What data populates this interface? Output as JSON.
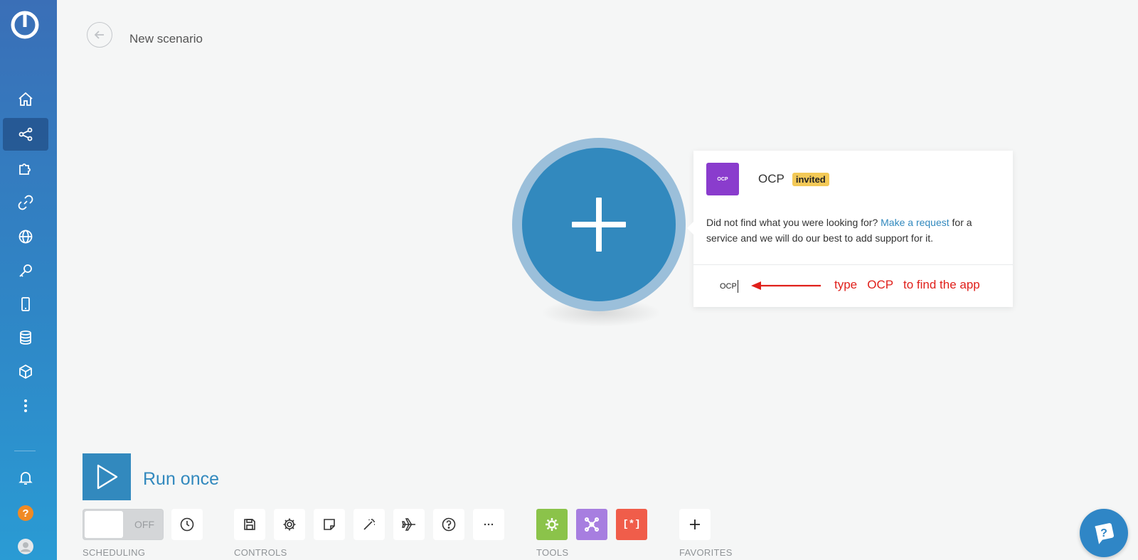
{
  "header": {
    "title": "New scenario"
  },
  "sidebar": {
    "items": [
      {
        "icon": "home-icon"
      },
      {
        "icon": "scenarios-icon",
        "active": true
      },
      {
        "icon": "puzzle-icon"
      },
      {
        "icon": "link-icon"
      },
      {
        "icon": "globe-icon"
      },
      {
        "icon": "key-icon"
      },
      {
        "icon": "device-icon"
      },
      {
        "icon": "database-icon"
      },
      {
        "icon": "cube-icon"
      },
      {
        "icon": "more-vertical-icon"
      }
    ],
    "bottom": [
      {
        "icon": "bell-icon"
      },
      {
        "icon": "help-icon",
        "color": "#f08a24"
      },
      {
        "icon": "avatar"
      }
    ]
  },
  "popup": {
    "app": {
      "icon_text": "OCP",
      "name": "OCP",
      "badge": "invited",
      "icon_color": "#8a3ccd",
      "badge_color": "#f3c957"
    },
    "help_prefix": "Did not find what you were looking for?",
    "help_link": "Make a request",
    "help_suffix": "for a service and we will do our best to add support for it.",
    "search_value": "OCP"
  },
  "annotation": {
    "text": "type   OCP   to find the app",
    "color": "#e0201b"
  },
  "run": {
    "label": "Run once"
  },
  "toolbar": {
    "scheduling": {
      "toggle_label": "OFF",
      "section_label": "SCHEDULING"
    },
    "controls": {
      "section_label": "CONTROLS",
      "buttons": [
        "save-icon",
        "settings-icon",
        "notes-icon",
        "auto-align-icon",
        "flight-icon",
        "question-icon",
        "more-horizontal-icon"
      ],
      "more_label": "···"
    },
    "tools": {
      "section_label": "TOOLS",
      "buttons": [
        {
          "icon": "gear-tool-icon",
          "color": "#8bc34a"
        },
        {
          "icon": "flow-control-icon",
          "color": "#a77ee0"
        },
        {
          "icon": "text-parser-icon",
          "color": "#f05d4a",
          "text": "[*]"
        }
      ]
    },
    "favorites": {
      "section_label": "FAVORITES",
      "add_label": "+"
    }
  },
  "colors": {
    "accent": "#3289be",
    "background": "#f5f6f6"
  }
}
